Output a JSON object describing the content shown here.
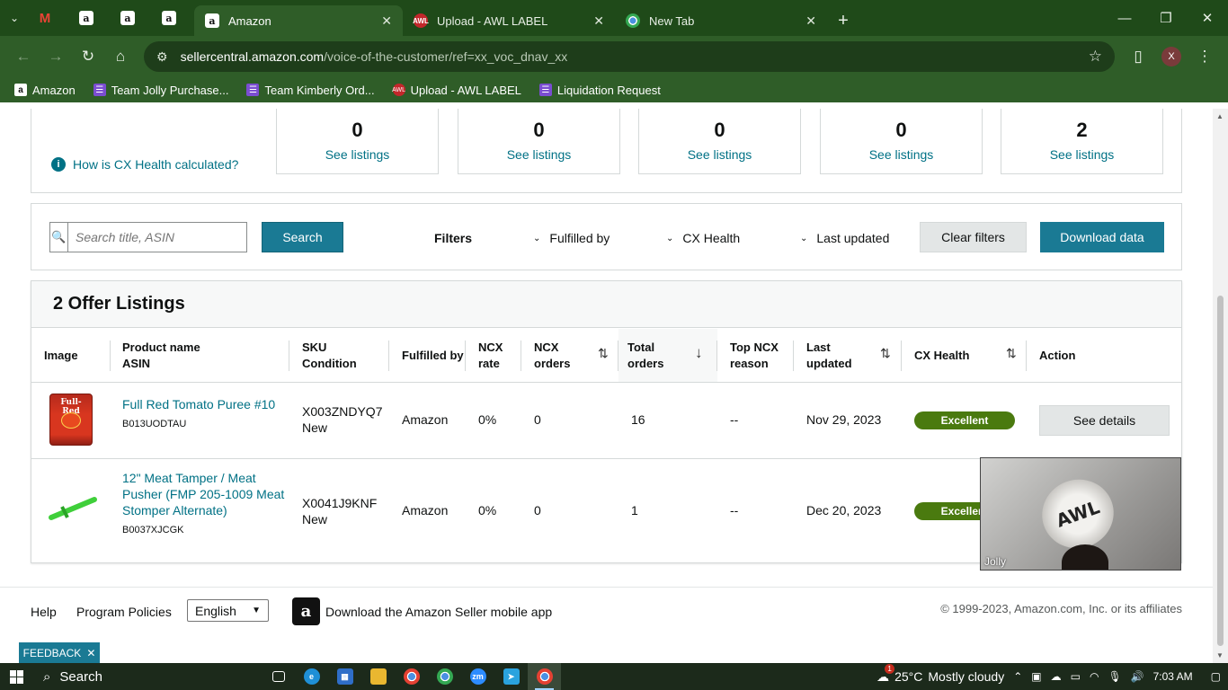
{
  "browser": {
    "tabs": [
      {
        "label": "Amazon",
        "active": true
      },
      {
        "label": "Upload - AWL LABEL",
        "active": false
      },
      {
        "label": "New Tab",
        "active": false
      }
    ],
    "url_host": "sellercentral.amazon.com",
    "url_path": "/voice-of-the-customer/ref=xx_voc_dnav_xx",
    "profile_initial": "X",
    "bookmarks": [
      "Amazon",
      "Team Jolly Purchase...",
      "Team Kimberly Ord...",
      "Upload - AWL LABEL",
      "Liquidation Request"
    ]
  },
  "summary": {
    "help_link": "How is CX Health calculated?",
    "cards": [
      {
        "count": "0",
        "link": "See listings",
        "color": "#c7312b"
      },
      {
        "count": "0",
        "link": "See listings",
        "color": "#f0a30a"
      },
      {
        "count": "0",
        "link": "See listings",
        "color": "#e2c600"
      },
      {
        "count": "0",
        "link": "See listings",
        "color": "#8db51b"
      },
      {
        "count": "2",
        "link": "See listings",
        "color": "#4a7a0f"
      }
    ]
  },
  "filters": {
    "search_placeholder": "Search title, ASIN",
    "search_button": "Search",
    "label": "Filters",
    "dropdowns": [
      "Fulfilled by",
      "CX Health",
      "Last updated"
    ],
    "clear_button": "Clear filters",
    "download_button": "Download data"
  },
  "listings": {
    "title": "2 Offer Listings",
    "columns": {
      "image": "Image",
      "product_name": "Product name",
      "asin": "ASIN",
      "sku": "SKU",
      "condition": "Condition",
      "fulfilled_by": "Fulfilled by",
      "ncx_rate_1": "NCX",
      "ncx_rate_2": "rate",
      "ncx_orders_1": "NCX",
      "ncx_orders_2": "orders",
      "total_orders_1": "Total",
      "total_orders_2": "orders",
      "top_ncx_1": "Top NCX",
      "top_ncx_2": "reason",
      "last_updated_1": "Last",
      "last_updated_2": "updated",
      "cx_health": "CX Health",
      "action": "Action"
    },
    "rows": [
      {
        "product_name": "Full Red Tomato Puree #10",
        "asin": "B013UODTAU",
        "sku": "X003ZNDYQ7",
        "condition": "New",
        "fulfilled_by": "Amazon",
        "ncx_rate": "0%",
        "ncx_orders": "0",
        "total_orders": "16",
        "top_ncx_reason": "--",
        "last_updated": "Nov 29, 2023",
        "cx_health": "Excellent",
        "action": "See details",
        "image_label": "Full-Red"
      },
      {
        "product_name_line1": "12\" Meat Tamper / Meat",
        "product_name_line2": "Pusher (FMP 205-1009 Meat",
        "product_name_line3": "Stomper Alternate)",
        "asin": "B0037XJCGK",
        "sku": "X0041J9KNF",
        "condition": "New",
        "fulfilled_by": "Amazon",
        "ncx_rate": "0%",
        "ncx_orders": "0",
        "total_orders": "1",
        "top_ncx_reason": "--",
        "last_updated": "Dec 20, 2023",
        "cx_health": "Excellent"
      }
    ]
  },
  "video": {
    "name": "Jolly",
    "logo_text": "AWL"
  },
  "footer": {
    "help": "Help",
    "program_policies": "Program Policies",
    "language": "English",
    "app_link": "Download the Amazon Seller mobile app",
    "copyright": "© 1999-2023, Amazon.com, Inc. or its affiliates",
    "feedback": "FEEDBACK"
  },
  "taskbar": {
    "search": "Search",
    "temperature": "25°C",
    "weather": "Mostly cloudy",
    "weather_badge": "1",
    "time": "7:03 AM"
  }
}
